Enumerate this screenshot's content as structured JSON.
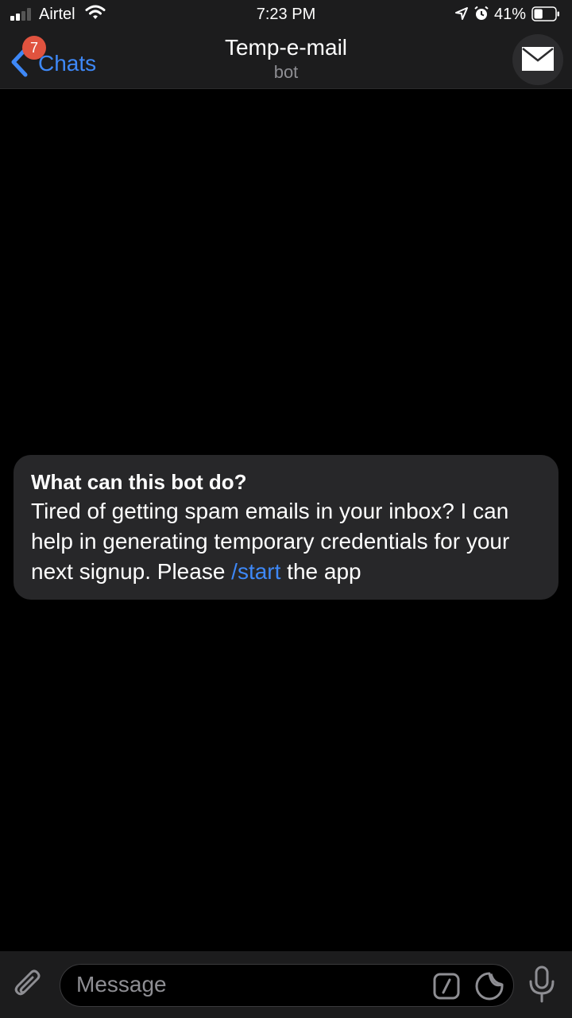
{
  "status_bar": {
    "carrier": "Airtel",
    "time": "7:23 PM",
    "battery_percent": "41%",
    "battery_level": 0.41,
    "signal_bars_filled": 2,
    "signal_bars_total": 4,
    "icons": [
      "signal-icon",
      "wifi-icon",
      "location-icon",
      "alarm-icon",
      "battery-icon"
    ]
  },
  "nav": {
    "back_label": "Chats",
    "unread_badge": "7",
    "title": "Temp-e-mail",
    "subtitle": "bot",
    "avatar_icon": "envelope-icon"
  },
  "info_card": {
    "title": "What can this bot do?",
    "body_before_link": "Tired of getting spam emails in your inbox?  I can help in generating temporary credentials for your next signup. Please ",
    "link_text": "/start",
    "body_after_link": " the app"
  },
  "input_bar": {
    "placeholder": "Message",
    "icons": [
      "paperclip-icon",
      "bot-command-icon",
      "sticker-icon",
      "microphone-icon"
    ]
  },
  "colors": {
    "accent": "#3e88f7",
    "badge": "#e0533f",
    "background": "#000000",
    "bar": "#1c1c1d",
    "card": "#272729",
    "secondary_text": "#8e8e93"
  }
}
